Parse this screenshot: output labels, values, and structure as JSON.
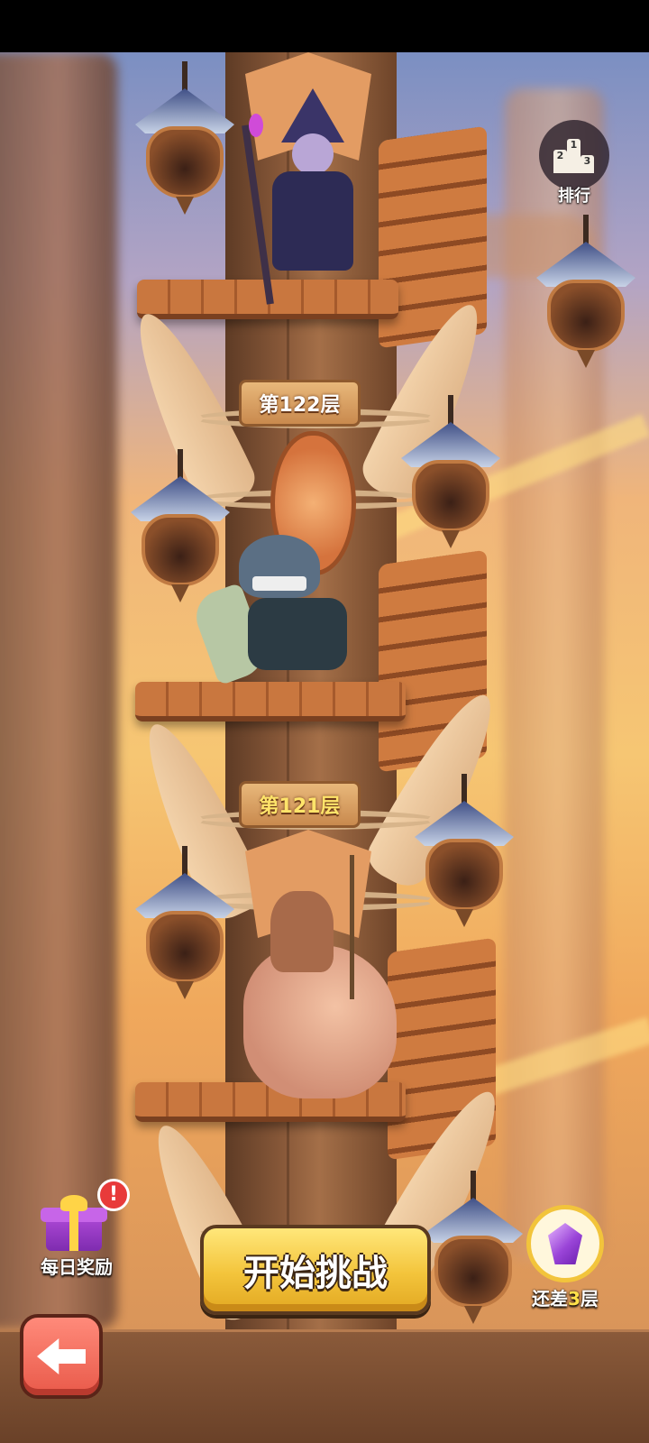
{
  "tower": {
    "floor_signs": [
      {
        "label": "第122层",
        "state": "next"
      },
      {
        "label": "第121层",
        "state": "current"
      }
    ]
  },
  "ranking": {
    "label": "排行",
    "podium_digits": [
      "2",
      "1",
      "3"
    ],
    "icon": "podium-icon"
  },
  "daily_reward": {
    "label": "每日奖励",
    "badge": "!",
    "icon": "gift-icon"
  },
  "start_challenge": {
    "label": "开始挑战"
  },
  "gem_reward": {
    "prefix": "还差",
    "count": "3",
    "suffix": "层",
    "icon": "purple-gem-icon"
  },
  "back": {
    "icon": "left-arrow-icon"
  },
  "colors": {
    "start_button": "#f3c43b",
    "back_button": "#e95a4a",
    "highlight": "#ffe14a",
    "badge": "#e83a3a"
  }
}
